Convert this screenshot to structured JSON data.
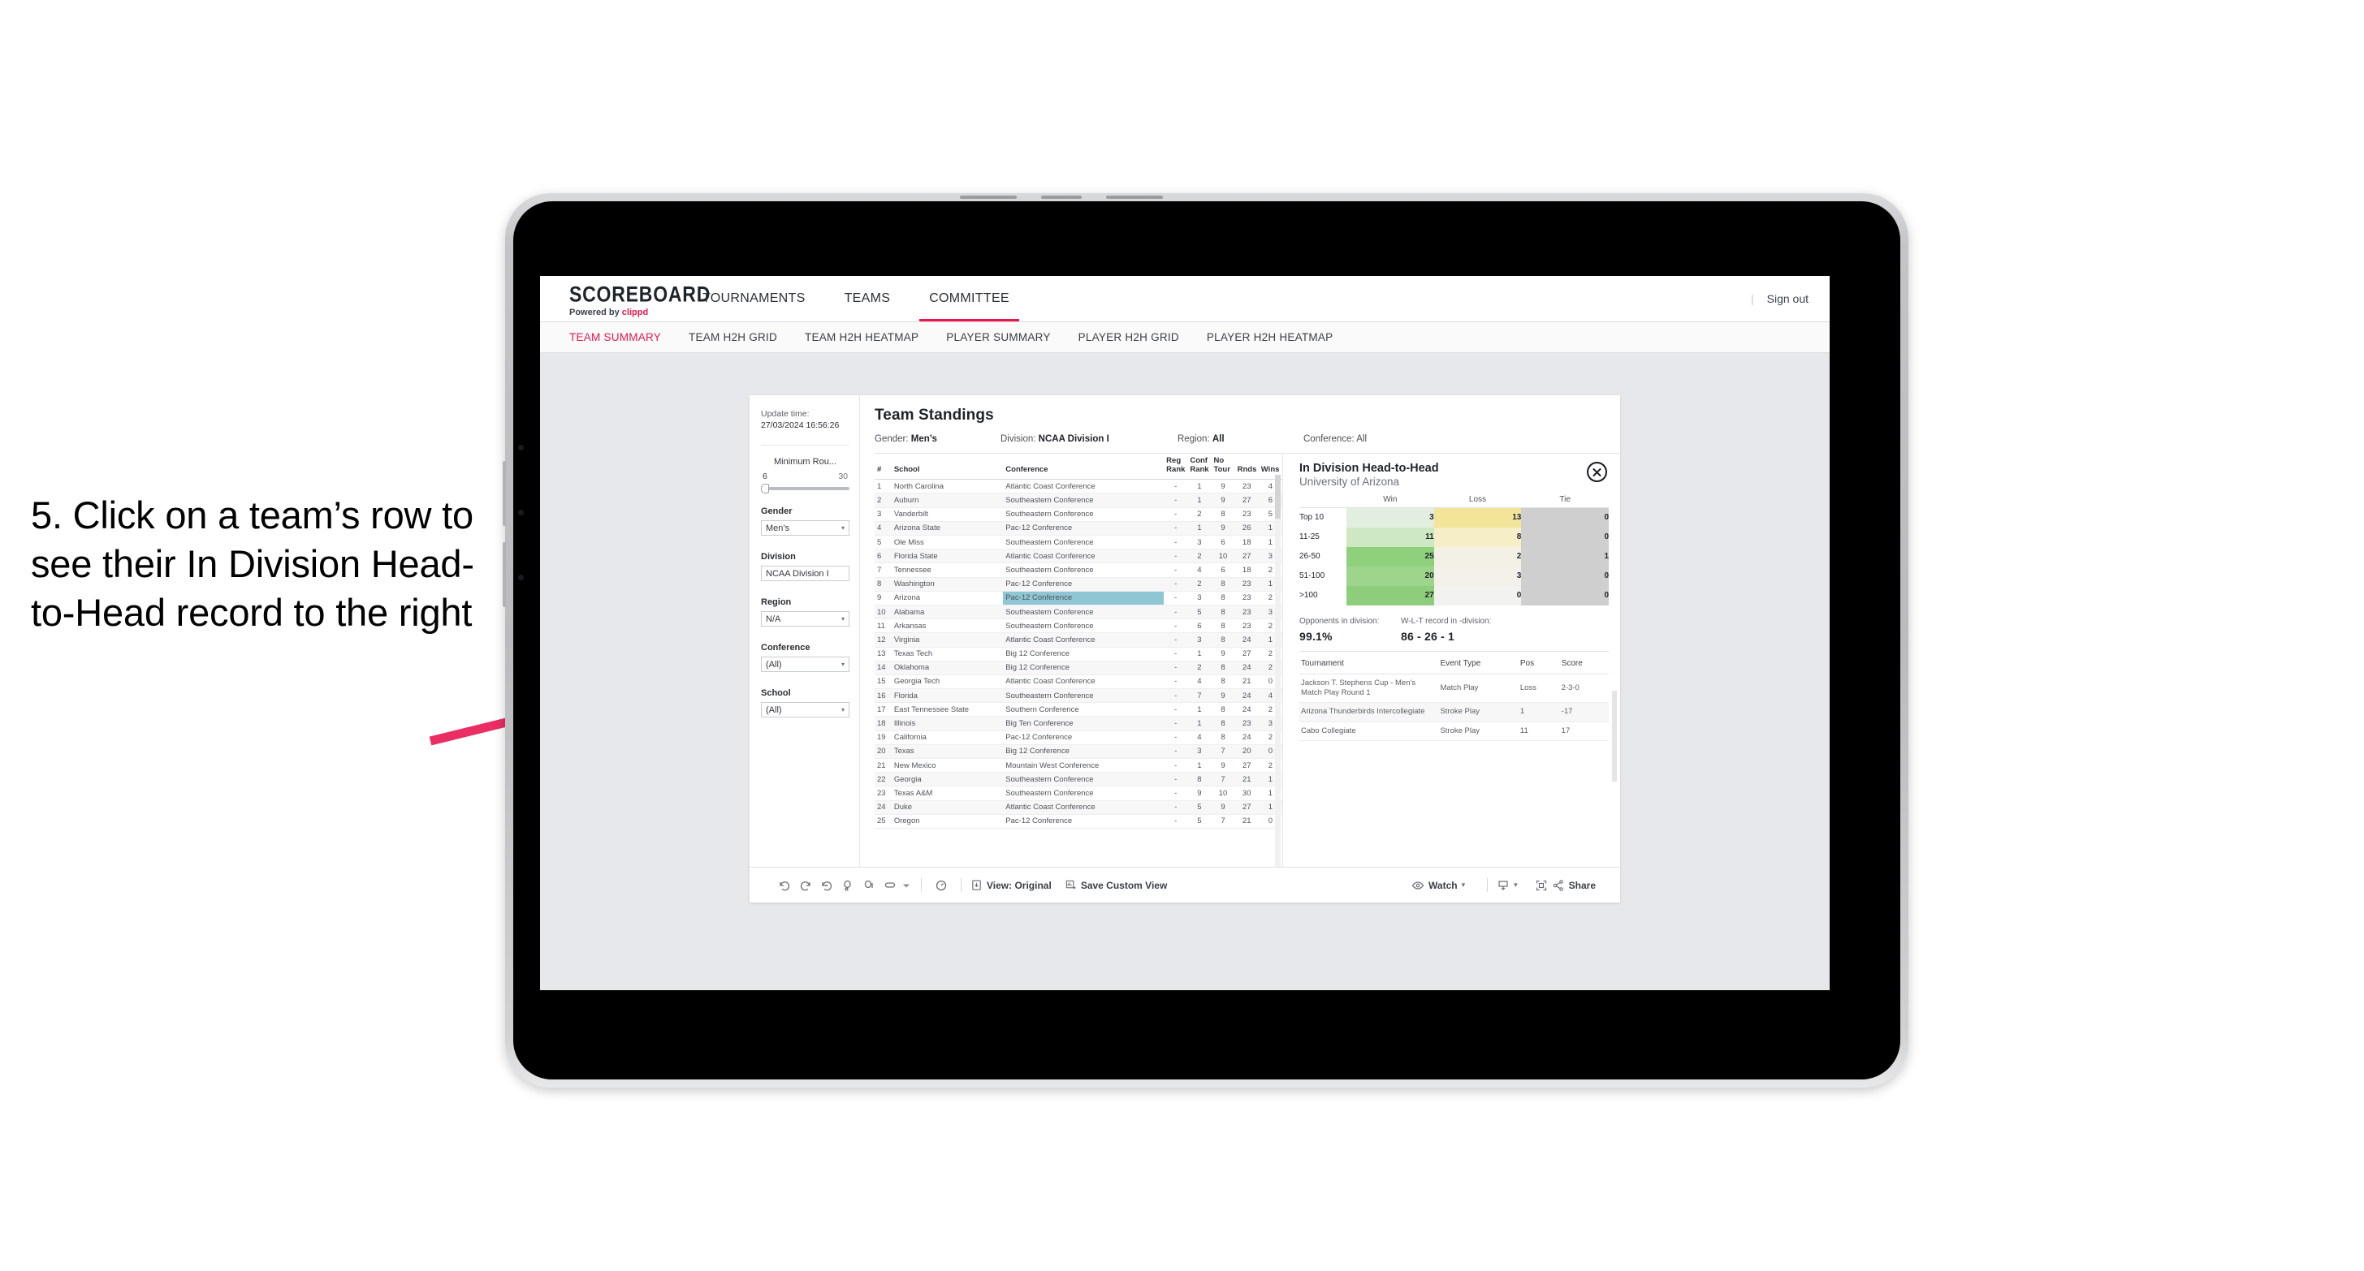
{
  "annotation": {
    "text": "5. Click on a team’s row to see their In Division Head-to-Head record to the right",
    "arrow_color": "#ea2d63"
  },
  "topnav": {
    "brand": "SCOREBOARD",
    "brand_sub_prefix": "Powered by ",
    "brand_sub_accent": "clippd",
    "items": [
      {
        "label": "TOURNAMENTS",
        "active": false
      },
      {
        "label": "TEAMS",
        "active": false
      },
      {
        "label": "COMMITTEE",
        "active": true
      }
    ],
    "divider": "|",
    "sign_out": "Sign out",
    "accent_color": "#e8174c"
  },
  "subnav": {
    "items": [
      {
        "label": "TEAM SUMMARY",
        "active": true
      },
      {
        "label": "TEAM H2H GRID",
        "active": false
      },
      {
        "label": "TEAM H2H HEATMAP",
        "active": false
      },
      {
        "label": "PLAYER SUMMARY",
        "active": false
      },
      {
        "label": "PLAYER H2H GRID",
        "active": false
      },
      {
        "label": "PLAYER H2H HEATMAP",
        "active": false
      }
    ]
  },
  "sidebar": {
    "update_label": "Update time:",
    "update_value": "27/03/2024 16:56:26",
    "slider": {
      "title": "Minimum Rou...",
      "min": "6",
      "max": "30"
    },
    "filters": [
      {
        "label": "Gender",
        "value": "Men’s",
        "caret": "▾"
      },
      {
        "label": "Division",
        "value": "NCAA Division I",
        "caret": ""
      },
      {
        "label": "Region",
        "value": "N/A",
        "caret": "▾"
      },
      {
        "label": "Conference",
        "value": "(All)",
        "caret": "▾"
      },
      {
        "label": "School",
        "value": "(All)",
        "caret": "▾"
      }
    ]
  },
  "sheet": {
    "title": "Team Standings",
    "crumbs": [
      {
        "label": "Gender: ",
        "value": "Men’s"
      },
      {
        "label": "Division: ",
        "value": "NCAA Division I"
      },
      {
        "label": "Region: ",
        "value": "All"
      },
      {
        "label": "Conference: ",
        "value": "All"
      }
    ]
  },
  "standings": {
    "columns": [
      "#",
      "School",
      "Conference",
      "Reg Rank",
      "Conf Rank",
      "No Tour",
      "Rnds",
      "Wins"
    ],
    "rows": [
      {
        "n": "1",
        "school": "North Carolina",
        "conf": "Atlantic Coast Conference",
        "reg": "-",
        "cr": "1",
        "nt": "9",
        "rnds": "23",
        "wins": "4",
        "hl": false
      },
      {
        "n": "2",
        "school": "Auburn",
        "conf": "Southeastern Conference",
        "reg": "-",
        "cr": "1",
        "nt": "9",
        "rnds": "27",
        "wins": "6",
        "hl": false
      },
      {
        "n": "3",
        "school": "Vanderbilt",
        "conf": "Southeastern Conference",
        "reg": "-",
        "cr": "2",
        "nt": "8",
        "rnds": "23",
        "wins": "5",
        "hl": false
      },
      {
        "n": "4",
        "school": "Arizona State",
        "conf": "Pac-12 Conference",
        "reg": "-",
        "cr": "1",
        "nt": "9",
        "rnds": "26",
        "wins": "1",
        "hl": false
      },
      {
        "n": "5",
        "school": "Ole Miss",
        "conf": "Southeastern Conference",
        "reg": "-",
        "cr": "3",
        "nt": "6",
        "rnds": "18",
        "wins": "1",
        "hl": false
      },
      {
        "n": "6",
        "school": "Florida State",
        "conf": "Atlantic Coast Conference",
        "reg": "-",
        "cr": "2",
        "nt": "10",
        "rnds": "27",
        "wins": "3",
        "hl": false
      },
      {
        "n": "7",
        "school": "Tennessee",
        "conf": "Southeastern Conference",
        "reg": "-",
        "cr": "4",
        "nt": "6",
        "rnds": "18",
        "wins": "2",
        "hl": false
      },
      {
        "n": "8",
        "school": "Washington",
        "conf": "Pac-12 Conference",
        "reg": "-",
        "cr": "2",
        "nt": "8",
        "rnds": "23",
        "wins": "1",
        "hl": false
      },
      {
        "n": "9",
        "school": "Arizona",
        "conf": "Pac-12 Conference",
        "reg": "-",
        "cr": "3",
        "nt": "8",
        "rnds": "23",
        "wins": "2",
        "hl": true
      },
      {
        "n": "10",
        "school": "Alabama",
        "conf": "Southeastern Conference",
        "reg": "-",
        "cr": "5",
        "nt": "8",
        "rnds": "23",
        "wins": "3",
        "hl": false
      },
      {
        "n": "11",
        "school": "Arkansas",
        "conf": "Southeastern Conference",
        "reg": "-",
        "cr": "6",
        "nt": "8",
        "rnds": "23",
        "wins": "2",
        "hl": false
      },
      {
        "n": "12",
        "school": "Virginia",
        "conf": "Atlantic Coast Conference",
        "reg": "-",
        "cr": "3",
        "nt": "8",
        "rnds": "24",
        "wins": "1",
        "hl": false
      },
      {
        "n": "13",
        "school": "Texas Tech",
        "conf": "Big 12 Conference",
        "reg": "-",
        "cr": "1",
        "nt": "9",
        "rnds": "27",
        "wins": "2",
        "hl": false
      },
      {
        "n": "14",
        "school": "Oklahoma",
        "conf": "Big 12 Conference",
        "reg": "-",
        "cr": "2",
        "nt": "8",
        "rnds": "24",
        "wins": "2",
        "hl": false
      },
      {
        "n": "15",
        "school": "Georgia Tech",
        "conf": "Atlantic Coast Conference",
        "reg": "-",
        "cr": "4",
        "nt": "8",
        "rnds": "21",
        "wins": "0",
        "hl": false
      },
      {
        "n": "16",
        "school": "Florida",
        "conf": "Southeastern Conference",
        "reg": "-",
        "cr": "7",
        "nt": "9",
        "rnds": "24",
        "wins": "4",
        "hl": false
      },
      {
        "n": "17",
        "school": "East Tennessee State",
        "conf": "Southern Conference",
        "reg": "-",
        "cr": "1",
        "nt": "8",
        "rnds": "24",
        "wins": "2",
        "hl": false
      },
      {
        "n": "18",
        "school": "Illinois",
        "conf": "Big Ten Conference",
        "reg": "-",
        "cr": "1",
        "nt": "8",
        "rnds": "23",
        "wins": "3",
        "hl": false
      },
      {
        "n": "19",
        "school": "California",
        "conf": "Pac-12 Conference",
        "reg": "-",
        "cr": "4",
        "nt": "8",
        "rnds": "24",
        "wins": "2",
        "hl": false
      },
      {
        "n": "20",
        "school": "Texas",
        "conf": "Big 12 Conference",
        "reg": "-",
        "cr": "3",
        "nt": "7",
        "rnds": "20",
        "wins": "0",
        "hl": false
      },
      {
        "n": "21",
        "school": "New Mexico",
        "conf": "Mountain West Conference",
        "reg": "-",
        "cr": "1",
        "nt": "9",
        "rnds": "27",
        "wins": "2",
        "hl": false
      },
      {
        "n": "22",
        "school": "Georgia",
        "conf": "Southeastern Conference",
        "reg": "-",
        "cr": "8",
        "nt": "7",
        "rnds": "21",
        "wins": "1",
        "hl": false
      },
      {
        "n": "23",
        "school": "Texas A&M",
        "conf": "Southeastern Conference",
        "reg": "-",
        "cr": "9",
        "nt": "10",
        "rnds": "30",
        "wins": "1",
        "hl": false
      },
      {
        "n": "24",
        "school": "Duke",
        "conf": "Atlantic Coast Conference",
        "reg": "-",
        "cr": "5",
        "nt": "9",
        "rnds": "27",
        "wins": "1",
        "hl": false
      },
      {
        "n": "25",
        "school": "Oregon",
        "conf": "Pac-12 Conference",
        "reg": "-",
        "cr": "5",
        "nt": "7",
        "rnds": "21",
        "wins": "0",
        "hl": false
      }
    ],
    "highlight_color": "#8fc6d4"
  },
  "h2h": {
    "title": "In Division Head-to-Head",
    "subtitle": "University of Arizona",
    "close_icon": "close-icon",
    "columns": [
      "",
      "Win",
      "Loss",
      "Tie"
    ],
    "rows": [
      {
        "label": "Top 10",
        "win": "3",
        "loss": "13",
        "tie": "0",
        "win_bg": "#e2efe0",
        "loss_bg": "#f2e59a",
        "tie_bg": "#cfcfcf"
      },
      {
        "label": "11-25",
        "win": "11",
        "loss": "8",
        "tie": "0",
        "win_bg": "#cfe8c4",
        "loss_bg": "#f6eec6",
        "tie_bg": "#cfcfcf"
      },
      {
        "label": "26-50",
        "win": "25",
        "loss": "2",
        "tie": "1",
        "win_bg": "#8fd07d",
        "loss_bg": "#f3f0e6",
        "tie_bg": "#cfcfcf"
      },
      {
        "label": "51-100",
        "win": "20",
        "loss": "3",
        "tie": "0",
        "win_bg": "#9ed58c",
        "loss_bg": "#f3f1e9",
        "tie_bg": "#cfcfcf"
      },
      {
        "label": ">100",
        "win": "27",
        "loss": "0",
        "tie": "0",
        "win_bg": "#8ecd7c",
        "loss_bg": "#f2f2f0",
        "tie_bg": "#cfcfcf"
      }
    ],
    "stats": [
      {
        "label": "Opponents in division:",
        "value": "99.1%"
      },
      {
        "label": "W-L-T record in -division:",
        "value": "86 - 26 - 1"
      }
    ],
    "tourn_columns": [
      "Tournament",
      "Event Type",
      "Pos",
      "Score"
    ],
    "tournaments": [
      {
        "name": "Jackson T. Stephens Cup - Men’s Match Play Round 1",
        "type": "Match Play",
        "pos": "Loss",
        "score": "2-3-0"
      },
      {
        "name": "Arizona Thunderbirds Intercollegiate",
        "type": "Stroke Play",
        "pos": "1",
        "score": "-17"
      },
      {
        "name": "Cabo Collegiate",
        "type": "Stroke Play",
        "pos": "11",
        "score": "17"
      }
    ]
  },
  "toolbar": {
    "left_icons": [
      "undo-icon",
      "redo-icon",
      "revert-icon",
      "pause-icon",
      "resume-icon",
      "device-layout-icon",
      "chevron-down-icon"
    ],
    "refresh_icon": "refresh-icon",
    "view_button": {
      "icon": "view-icon",
      "label": "View: Original"
    },
    "save_button": {
      "icon": "save-view-icon",
      "label": "Save Custom View"
    },
    "watch_button": {
      "icon": "eye-icon",
      "label": "Watch",
      "caret": "▾"
    },
    "download_button": {
      "icon": "download-icon",
      "caret": "▾"
    },
    "fullscreen_icon": "fullscreen-icon",
    "share_button": {
      "icon": "share-icon",
      "label": "Share"
    }
  }
}
